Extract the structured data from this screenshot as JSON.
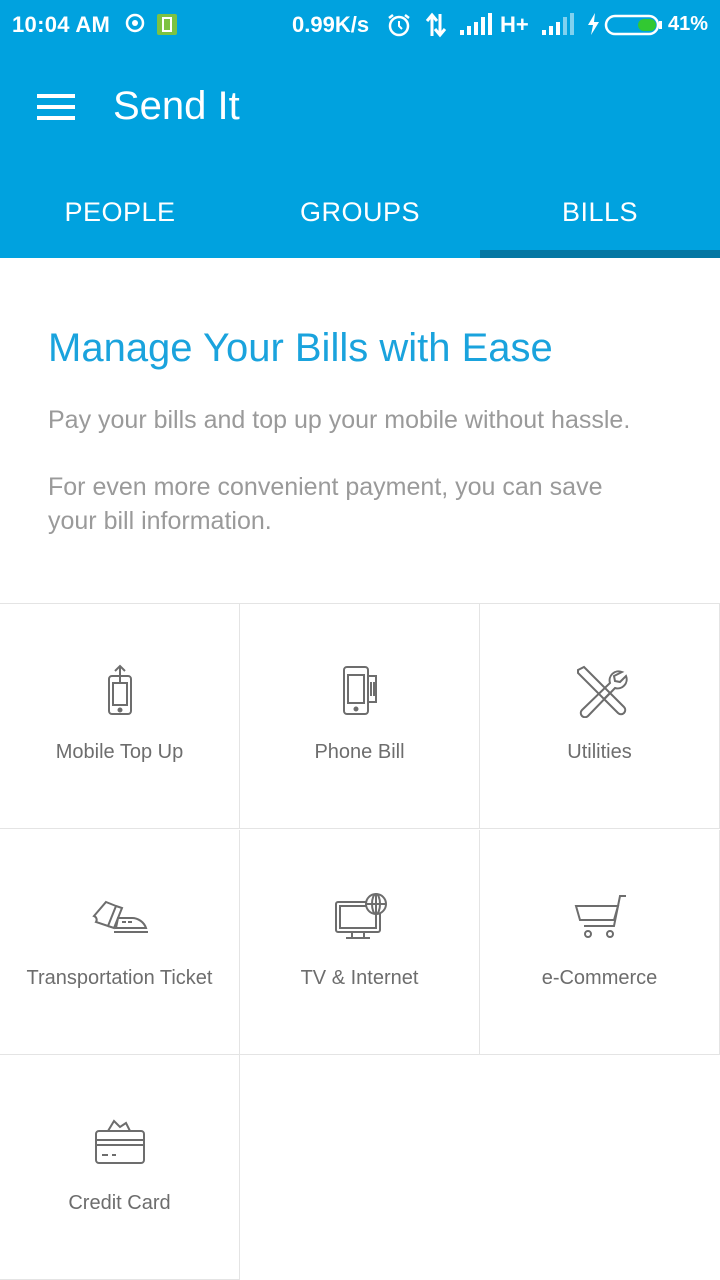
{
  "status_bar": {
    "time": "10:04 AM",
    "speed": "0.99K/s",
    "network": "H+",
    "battery": "41%",
    "icons": [
      "sync-icon",
      "battery-saver-icon",
      "alarm-icon",
      "data-transfer-icon",
      "signal-icon",
      "charging-icon",
      "battery-icon"
    ]
  },
  "toolbar": {
    "title": "Send It"
  },
  "tabs": [
    {
      "label": "PEOPLE"
    },
    {
      "label": "GROUPS"
    },
    {
      "label": "BILLS",
      "active": true
    }
  ],
  "intro": {
    "title": "Manage Your Bills with Ease",
    "p1": "Pay your bills and top up your mobile without hassle.",
    "p2_line1": "For even more convenient payment, you can save",
    "p2_line2": "your bill information."
  },
  "bills": [
    {
      "label": "Mobile Top Up",
      "icon": "mobile-topup-icon"
    },
    {
      "label": "Phone Bill",
      "icon": "phone-bill-icon"
    },
    {
      "label": "Utilities",
      "icon": "utilities-icon"
    },
    {
      "label": "Transportation Ticket",
      "icon": "ticket-icon"
    },
    {
      "label": "TV & Internet",
      "icon": "tv-internet-icon"
    },
    {
      "label": "e-Commerce",
      "icon": "cart-icon"
    },
    {
      "label": "Credit Card",
      "icon": "credit-card-icon"
    }
  ],
  "colors": {
    "primary": "#00a2df",
    "tab_indicator": "#0577a3",
    "heading": "#1aa3dd",
    "body_text": "#9a9a9a",
    "label": "#6d6d6d"
  }
}
